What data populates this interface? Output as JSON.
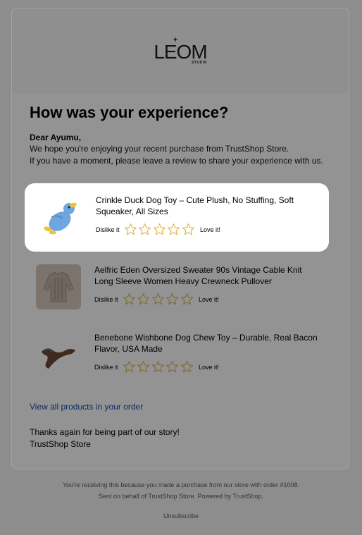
{
  "brand": {
    "name": "LEOM",
    "sub": "STUDIO"
  },
  "headline": "How was your experience?",
  "greeting": "Dear Ayumu,",
  "intro_line1": "We hope you're enjoying your recent purchase from TrustShop Store.",
  "intro_line2": "If you have a moment, please leave a review to share your experience with us.",
  "rating_labels": {
    "low": "Dislike it",
    "high": "Love it!"
  },
  "products": [
    {
      "name": "Crinkle Duck Dog Toy – Cute Plush, No Stuffing, Soft Squeaker, All Sizes",
      "stars": 5,
      "icon": "duck-toy-image",
      "highlighted": true
    },
    {
      "name": "Aelfric Eden Oversized Sweater 90s Vintage Cable Knit Long Sleeve Women Heavy Crewneck Pullover",
      "stars": 5,
      "icon": "sweater-image"
    },
    {
      "name": "Benebone Wishbone Dog Chew Toy – Durable, Real Bacon Flavor, USA Made",
      "stars": 5,
      "icon": "wishbone-chew-image"
    }
  ],
  "view_all_link": "View all products in your order",
  "thanks_line1": "Thanks again for being part of our story!",
  "thanks_line2": "TrustShop Store",
  "footer_line1": "You're receiving this because you made a purchase from our store with order #1008.",
  "footer_line2": "Sent on behalf of TrustShop Store. Powered by TrustShop.",
  "unsubscribe": "Unsubscribe",
  "colors": {
    "overlay": "#8d8d8d",
    "star": "#e0b43a",
    "link": "#0b2a63"
  }
}
